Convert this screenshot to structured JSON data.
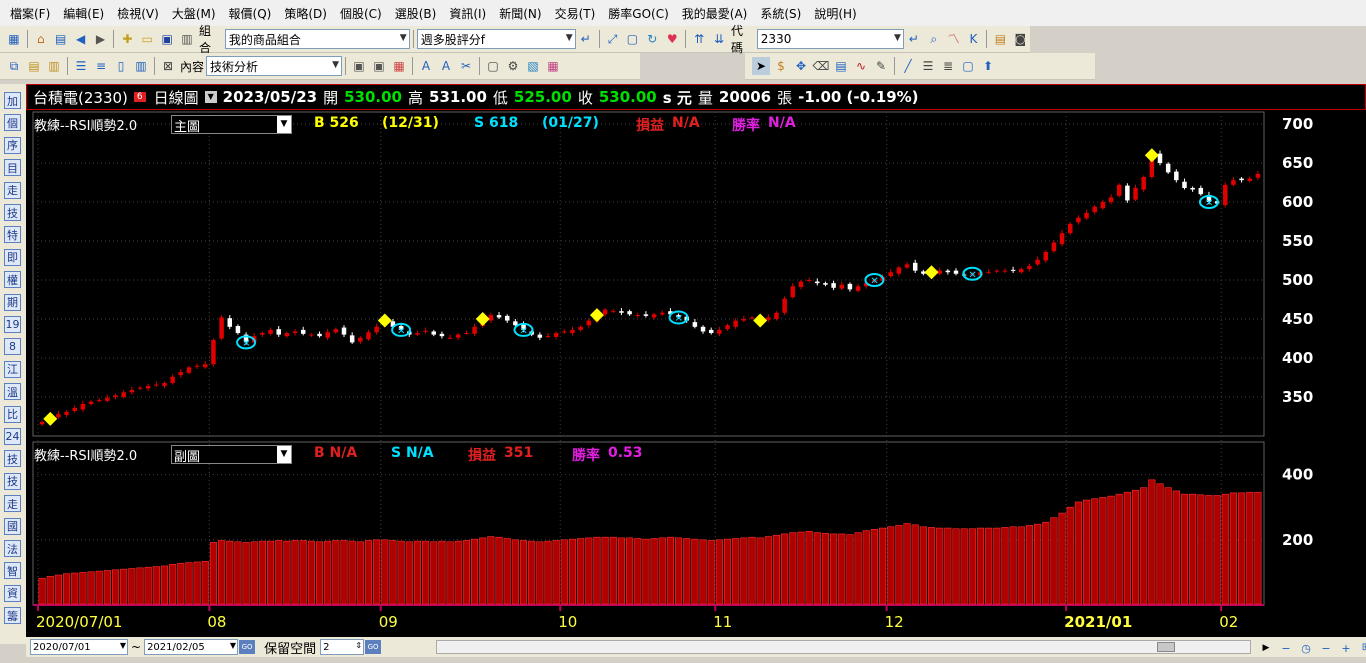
{
  "menu": [
    "檔案(F)",
    "編輯(E)",
    "檢視(V)",
    "大盤(M)",
    "報價(Q)",
    "策略(D)",
    "個股(C)",
    "選股(B)",
    "資訊(I)",
    "新聞(N)",
    "交易(T)",
    "勝率GO(C)",
    "我的最愛(A)",
    "系統(S)",
    "說明(H)"
  ],
  "toolbar": {
    "group_label": "組合",
    "group_value": "我的商品組合",
    "screener_value": "週多股評分f",
    "code_label": "代碼",
    "code_value": "2330",
    "content_label": "內容",
    "content_value": "技術分析"
  },
  "sidebar": [
    "加",
    "個",
    "序",
    "目",
    "走",
    "技",
    "特",
    "即",
    "權",
    "期",
    "19",
    "8",
    "江",
    "溫",
    "比",
    "24",
    "技",
    "技",
    "走",
    "國",
    "法",
    "智",
    "資",
    "籌"
  ],
  "header": {
    "stock": "台積電(2330)",
    "badge": "6",
    "chart_type": "日線圖",
    "date": "2023/05/23",
    "open_label": "開",
    "open": "530.00",
    "high_label": "高",
    "high": "531.00",
    "low_label": "低",
    "low": "525.00",
    "close_label": "收",
    "close": "530.00",
    "unit": "s 元",
    "volume_label": "量",
    "volume": "20006",
    "volume_unit": "張",
    "change": "-1.00 (-0.19%)"
  },
  "main_panel": {
    "indicator": "教練--RSI順勢2.0",
    "selector": "主圖",
    "buy": "B 526",
    "buy_date": "(12/31)",
    "sell": "S 618",
    "sell_date": "(01/27)",
    "pl_label": "損益",
    "pl": "N/A",
    "win_label": "勝率",
    "win": "N/A"
  },
  "sub_panel": {
    "indicator": "教練--RSI順勢2.0",
    "selector": "副圖",
    "buy": "B N/A",
    "sell": "S N/A",
    "pl_label": "損益",
    "pl": "351",
    "win_label": "勝率",
    "win": "0.53"
  },
  "bottom": {
    "from": "2020/07/01",
    "tilde": "~",
    "to": "2021/02/05",
    "keep_label": "保留空間",
    "keep_value": "2"
  },
  "colors": {
    "up": "#e00000",
    "down": "#ffffff",
    "buy": "#ffff00",
    "sell": "#00e0ff",
    "axis": "#c00060",
    "grid": "#404040"
  },
  "chart_data": {
    "type": "candlestick",
    "price_axis": [
      350,
      400,
      450,
      500,
      550,
      600,
      650,
      700
    ],
    "price_range": [
      300,
      700
    ],
    "x_ticks": [
      "2020/07/01",
      "08",
      "09",
      "10",
      "11",
      "12",
      "2021/01",
      "02"
    ],
    "x_tick_index": [
      0,
      21,
      42,
      64,
      83,
      104,
      126,
      145
    ],
    "close": [
      318,
      322,
      328,
      331,
      336,
      341,
      344,
      346,
      349,
      352,
      356,
      359,
      362,
      364,
      366,
      368,
      376,
      382,
      388,
      390,
      392,
      423,
      452,
      440,
      432,
      420,
      428,
      432,
      436,
      430,
      432,
      434,
      431,
      430,
      428,
      433,
      437,
      430,
      420,
      426,
      433,
      440,
      448,
      440,
      436,
      430,
      432,
      435,
      430,
      428,
      426,
      430,
      432,
      440,
      450,
      455,
      452,
      448,
      442,
      436,
      430,
      426,
      428,
      432,
      434,
      436,
      440,
      448,
      455,
      462,
      460,
      458,
      456,
      455,
      454,
      456,
      458,
      456,
      452,
      448,
      440,
      434,
      432,
      436,
      442,
      448,
      450,
      452,
      448,
      452,
      458,
      476,
      492,
      498,
      500,
      496,
      494,
      490,
      494,
      488,
      492,
      496,
      500,
      504,
      510,
      516,
      520,
      512,
      508,
      510,
      512,
      510,
      508,
      506,
      508,
      510,
      510,
      512,
      512,
      512,
      514,
      518,
      526,
      536,
      548,
      560,
      572,
      580,
      586,
      594,
      600,
      606,
      622,
      602,
      618,
      632,
      660,
      650,
      638,
      628,
      618,
      616,
      610,
      600,
      598,
      622,
      628,
      628,
      630,
      636
    ],
    "volume_axis": [
      200,
      400
    ],
    "volume": [
      82,
      88,
      92,
      96,
      98,
      100,
      102,
      104,
      106,
      108,
      110,
      112,
      114,
      116,
      118,
      120,
      125,
      128,
      130,
      132,
      134,
      192,
      198,
      196,
      194,
      192,
      194,
      196,
      196,
      198,
      196,
      198,
      198,
      196,
      194,
      196,
      198,
      198,
      196,
      194,
      198,
      200,
      200,
      198,
      196,
      194,
      196,
      196,
      194,
      196,
      194,
      196,
      198,
      202,
      206,
      210,
      208,
      204,
      200,
      198,
      196,
      194,
      196,
      198,
      200,
      202,
      204,
      206,
      208,
      208,
      208,
      206,
      206,
      204,
      202,
      204,
      206,
      208,
      206,
      204,
      202,
      200,
      198,
      200,
      202,
      204,
      206,
      208,
      206,
      210,
      214,
      218,
      222,
      224,
      226,
      222,
      220,
      218,
      218,
      216,
      222,
      228,
      232,
      236,
      240,
      244,
      250,
      246,
      240,
      238,
      236,
      236,
      234,
      234,
      234,
      236,
      236,
      236,
      238,
      240,
      240,
      244,
      248,
      254,
      268,
      282,
      300,
      316,
      322,
      326,
      330,
      334,
      340,
      346,
      352,
      360,
      384,
      372,
      360,
      350,
      340,
      340,
      338,
      336,
      336,
      340,
      344,
      344,
      346,
      346
    ],
    "buy_signals": [
      1,
      42,
      54,
      68,
      88,
      109,
      136
    ],
    "sell_signals": [
      25,
      44,
      59,
      78,
      102,
      114,
      143
    ]
  }
}
